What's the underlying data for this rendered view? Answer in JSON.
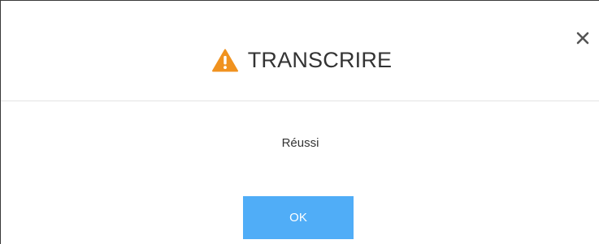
{
  "dialog": {
    "title": "TRANSCRIRE",
    "title_icon": "warning-triangle-icon",
    "close_icon": "close-icon",
    "message": "Réussi",
    "ok_label": "OK"
  },
  "colors": {
    "warning": "#f0921f",
    "button": "#50adf7",
    "button_text": "#ffffff",
    "divider": "#e3e3e3",
    "text": "#333333"
  }
}
